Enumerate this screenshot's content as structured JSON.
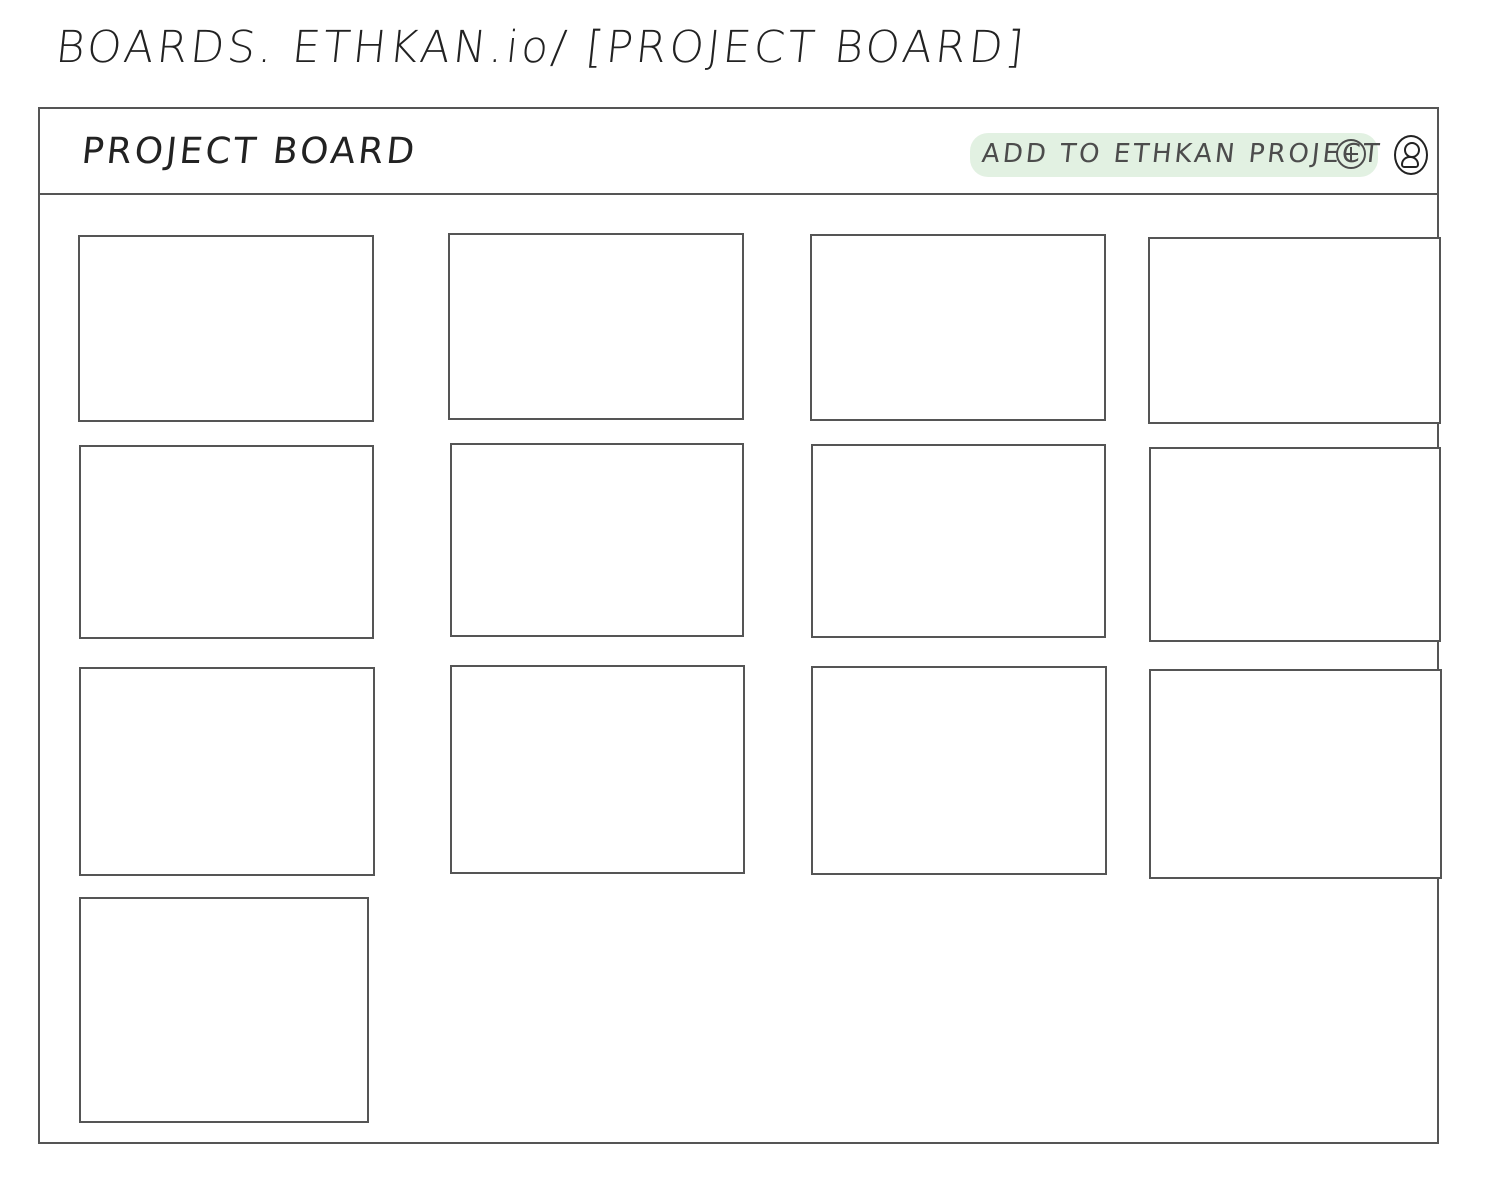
{
  "browser": {
    "url": "BOARDS. ETHKAN.io/ [PROJECT BOARD]"
  },
  "header": {
    "title": "PROJECT BOARD",
    "add_button_label": "ADD TO ETHKAN PROJECT",
    "add_icon": "plus-circle-icon",
    "user_icon": "user-avatar-icon"
  },
  "board": {
    "card_count": 13
  },
  "colors": {
    "highlight": "#cbe5cb",
    "stroke": "#555555"
  }
}
